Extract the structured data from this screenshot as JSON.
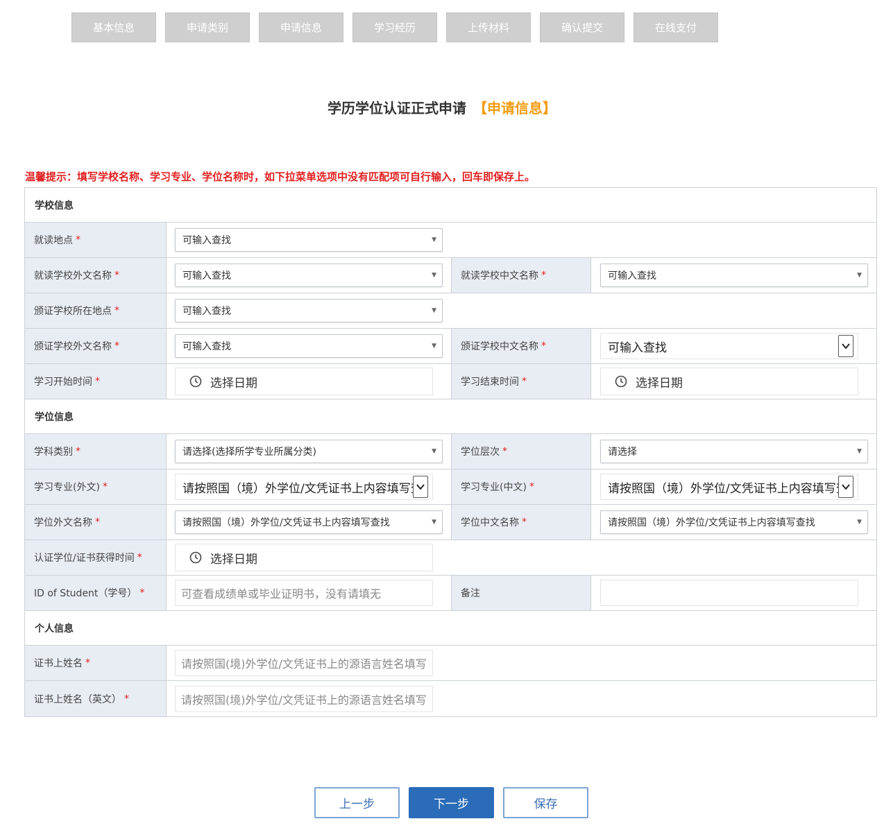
{
  "steps": [
    "基本信息",
    "申请类别",
    "申请信息",
    "学习经历",
    "上传材料",
    "确认提交",
    "在线支付"
  ],
  "title": {
    "main": "学历学位认证正式申请",
    "accent": "【申请信息】"
  },
  "tip": "温馨提示：填写学校名称、学习专业、学位名称时，如下拉菜单选项中没有匹配项可自行输入，回车即保存上。",
  "sections": {
    "school": "学校信息",
    "degree": "学位信息",
    "personal": "个人信息"
  },
  "fields": {
    "study_location": {
      "label": "就读地点",
      "value": "可输入查找"
    },
    "school_foreign": {
      "label": "就读学校外文名称",
      "value": "可输入查找"
    },
    "school_chinese": {
      "label": "就读学校中文名称",
      "value": "可输入查找"
    },
    "issuer_location": {
      "label": "颁证学校所在地点",
      "value": "可输入查找"
    },
    "issuer_foreign": {
      "label": "颁证学校外文名称",
      "value": "可输入查找"
    },
    "issuer_chinese": {
      "label": "颁证学校中文名称",
      "value": "可输入查找"
    },
    "start_time": {
      "label": "学习开始时间",
      "value": "选择日期"
    },
    "end_time": {
      "label": "学习结束时间",
      "value": "选择日期"
    },
    "subject_type": {
      "label": "学科类别",
      "value": "请选择(选择所学专业所属分类)"
    },
    "degree_level": {
      "label": "学位层次",
      "value": "请选择"
    },
    "major_foreign": {
      "label": "学习专业(外文)",
      "value": "请按照国（境）外学位/文凭证书上内容填写查找"
    },
    "major_chinese": {
      "label": "学习专业(中文)",
      "value": "请按照国（境）外学位/文凭证书上内容填写查找"
    },
    "degree_foreign": {
      "label": "学位外文名称",
      "value": "请按照国（境）外学位/文凭证书上内容填写查找"
    },
    "degree_chinese": {
      "label": "学位中文名称",
      "value": "请按照国（境）外学位/文凭证书上内容填写查找"
    },
    "cert_time": {
      "label": "认证学位/证书获得时间",
      "value": "选择日期"
    },
    "student_id": {
      "label": "ID of Student（学号）",
      "placeholder": "可查看成绩单或毕业证明书，没有请填无"
    },
    "remark": {
      "label": "备注",
      "value": ""
    },
    "cert_name": {
      "label": "证书上姓名",
      "placeholder": "请按照国(境)外学位/文凭证书上的源语言姓名填写"
    },
    "cert_name_en": {
      "label": "证书上姓名（英文）",
      "placeholder": "请按照国(境)外学位/文凭证书上的源语言姓名填写"
    }
  },
  "required_mark": "*",
  "buttons": {
    "prev": "上一步",
    "next": "下一步",
    "save": "保存"
  }
}
